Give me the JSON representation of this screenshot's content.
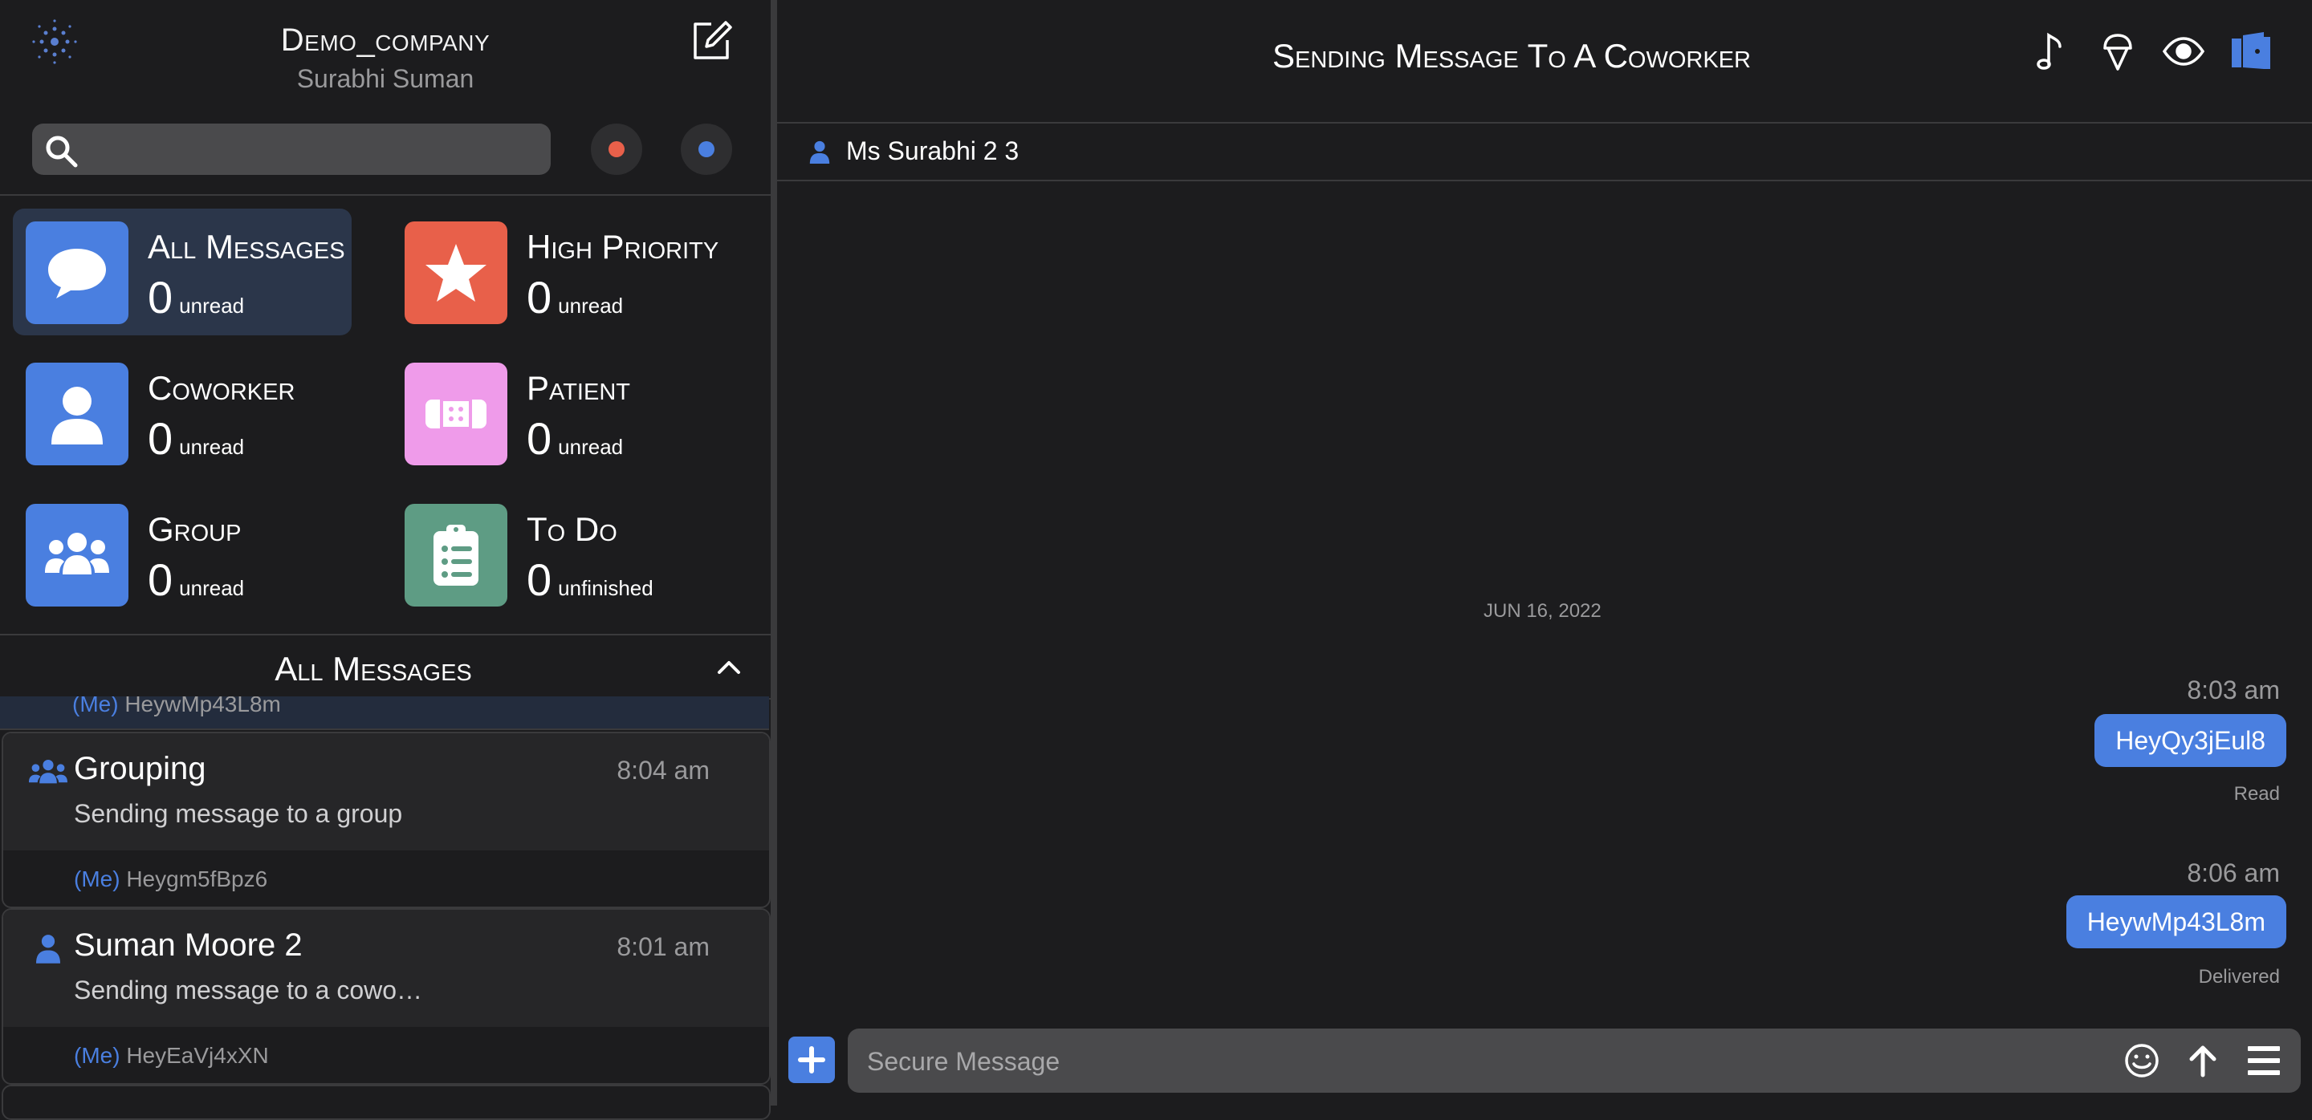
{
  "header": {
    "company": "Demo_company",
    "username": "Surabhi Suman"
  },
  "search": {
    "placeholder": "",
    "value": ""
  },
  "status_dots": {
    "left_color": "#e8604a",
    "right_color": "#4a7fe0"
  },
  "categories": [
    {
      "name": "All Messages",
      "count": "0",
      "unit": "unread",
      "icon": "chat-bubble-icon",
      "color": "#4a7fe0",
      "active": true
    },
    {
      "name": "High Priority",
      "count": "0",
      "unit": "unread",
      "icon": "star-icon",
      "color": "#e8604a",
      "active": false
    },
    {
      "name": "Coworker",
      "count": "0",
      "unit": "unread",
      "icon": "person-icon",
      "color": "#4a7fe0",
      "active": false
    },
    {
      "name": "Patient",
      "count": "0",
      "unit": "unread",
      "icon": "bandage-icon",
      "color": "#ef9bea",
      "active": false
    },
    {
      "name": "Group",
      "count": "0",
      "unit": "unread",
      "icon": "group-icon",
      "color": "#4a7fe0",
      "active": false
    },
    {
      "name": "To Do",
      "count": "0",
      "unit": "unfinished",
      "icon": "clipboard-icon",
      "color": "#5e9c84",
      "active": false
    }
  ],
  "list": {
    "title": "All Messages",
    "partial_item": {
      "me": "(Me)",
      "last": "HeywMp43L8m"
    },
    "conversations": [
      {
        "title": "Grouping",
        "time": "8:04 am",
        "subject": "Sending message to a group",
        "me": "(Me)",
        "last": "Heygm5fBpz6",
        "icon": "group-icon"
      },
      {
        "title": "Suman Moore 2",
        "time": "8:01 am",
        "subject": "Sending message to a cowo…",
        "me": "(Me)",
        "last": "HeyEaVj4xXN",
        "icon": "person-icon"
      }
    ]
  },
  "conversation": {
    "title": "Sending Message To A Coworker",
    "recipient": "Ms Surabhi 2 3",
    "date": "JUN 16, 2022",
    "messages": [
      {
        "time": "8:03 am",
        "text": "HeyQy3jEul8",
        "status": "Read"
      },
      {
        "time": "8:06 am",
        "text": "HeywMp43L8m",
        "status": "Delivered"
      }
    ],
    "input_placeholder": "Secure Message"
  },
  "toolbar_icons": [
    "music-note-icon",
    "ice-cream-icon",
    "eye-icon",
    "exit-door-icon"
  ],
  "accent": "#4a7fe0"
}
